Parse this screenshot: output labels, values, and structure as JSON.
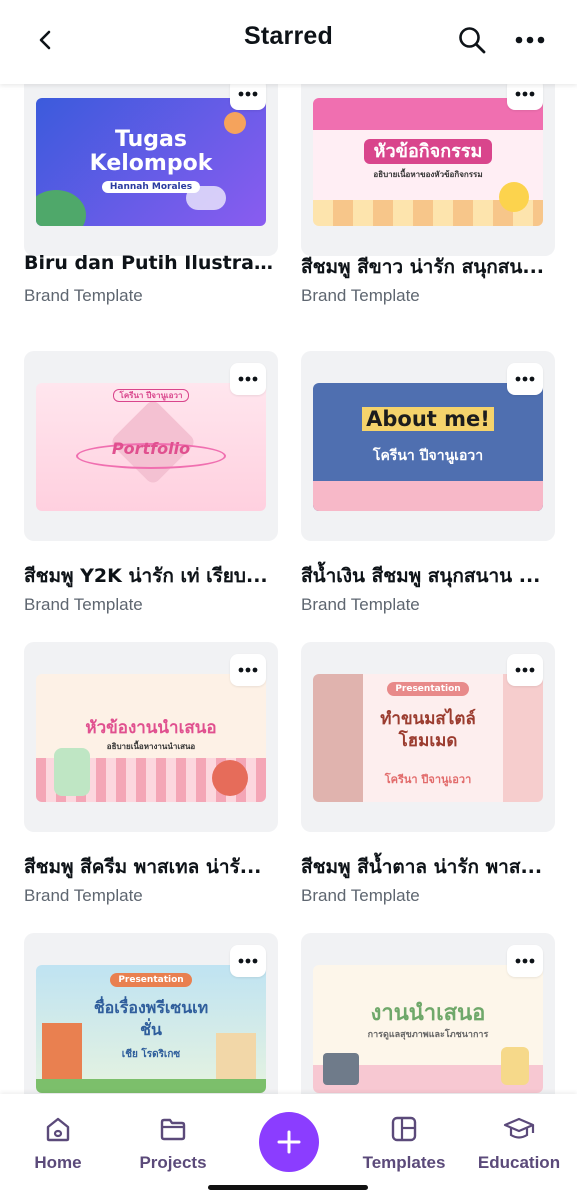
{
  "header": {
    "title": "Starred",
    "icons": [
      "chevron-left-icon",
      "search-icon",
      "more-icon"
    ]
  },
  "cards": [
    {
      "title": "Biru dan Putih Ilustrasi ...",
      "subtitle": "Brand Template",
      "art_title": "Tugas Kelompok",
      "art_sub": "Hannah Morales",
      "colors": [
        "#3b5bdc",
        "#8a5cf0"
      ]
    },
    {
      "title": "สีชมพู สีขาว น่ารัก สนุกสน...",
      "subtitle": "Brand Template",
      "art_title": "หัวข้อกิจกรรม",
      "art_sub": "อธิบายเนื้อหาของหัวข้อกิจกรรม",
      "colors": [
        "#f06fb0",
        "#ffe1ec"
      ]
    },
    {
      "title": "สีชมพู Y2K น่ารัก เท่ เรียบ...",
      "subtitle": "Brand Template",
      "art_title": "Portfolio",
      "art_sub": "โครีนา ปีจานูเอวา",
      "colors": [
        "#ffd3e2",
        "#ff9cc0"
      ]
    },
    {
      "title": "สีน้ำเงิน สีชมพู สนุกสนาน ...",
      "subtitle": "Brand Template",
      "art_title": "About me!",
      "art_sub": "โครีนา ปีจานูเอวา",
      "colors": [
        "#4f6fb0",
        "#f7b8c8"
      ]
    },
    {
      "title": "สีชมพู สีครีม พาสเทล น่ารั...",
      "subtitle": "Brand Template",
      "art_title": "หัวข้องานนำเสนอ",
      "art_sub": "อธิบายเนื้อหางานนำเสนอ",
      "colors": [
        "#fdf1e6",
        "#f4a6b6"
      ]
    },
    {
      "title": "สีชมพู สีน้ำตาล น่ารัก พาส...",
      "subtitle": "Brand Template",
      "art_title": "ทำขนมสไตล์โฮมเมด",
      "art_sub": "โครีนา ปีจานูเอวา",
      "badge": "Presentation",
      "colors": [
        "#fdeeee",
        "#e88a8a"
      ]
    },
    {
      "title": "",
      "subtitle": "",
      "art_title": "ชื่อเรื่องพรีเซนเทชั่น",
      "art_sub": "เชีย โรดริเกซ",
      "badge": "Presentation",
      "colors": [
        "#bfe3f2",
        "#e98050"
      ]
    },
    {
      "title": "",
      "subtitle": "",
      "art_title": "งานนำเสนอ",
      "art_sub": "การดูแลสุขภาพและโภชนาการ",
      "colors": [
        "#fdf6ea",
        "#f7c8d2"
      ]
    }
  ],
  "nav": {
    "items": [
      {
        "label": "Home",
        "icon": "home-icon"
      },
      {
        "label": "Projects",
        "icon": "folder-icon"
      },
      {
        "label": "Templates",
        "icon": "templates-icon"
      },
      {
        "label": "Education",
        "icon": "graduation-cap-icon"
      }
    ],
    "fab_icon": "plus-icon",
    "accent": "#8b3dff"
  }
}
